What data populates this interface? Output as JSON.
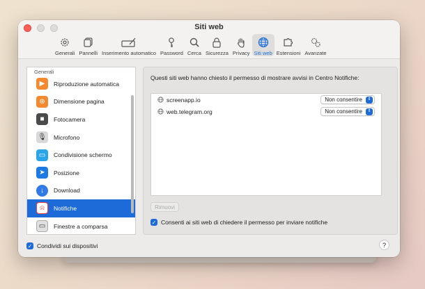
{
  "window": {
    "title": "Siti web"
  },
  "toolbar": {
    "items": [
      {
        "label": "Generali",
        "icon": "gear-icon"
      },
      {
        "label": "Pannelli",
        "icon": "tabs-icon"
      },
      {
        "label": "Inserimento automatico",
        "icon": "autofill-icon"
      },
      {
        "label": "Password",
        "icon": "key-icon"
      },
      {
        "label": "Cerca",
        "icon": "search-icon"
      },
      {
        "label": "Sicurezza",
        "icon": "lock-icon"
      },
      {
        "label": "Privacy",
        "icon": "hand-icon"
      },
      {
        "label": "Siti web",
        "icon": "globe-icon",
        "active": true
      },
      {
        "label": "Estensioni",
        "icon": "puzzle-icon"
      },
      {
        "label": "Avanzate",
        "icon": "gears-icon"
      }
    ]
  },
  "sidebar": {
    "header": "Generali",
    "items": [
      {
        "label": "Riproduzione automatica",
        "color": "#f5892d"
      },
      {
        "label": "Dimensione pagina",
        "color": "#f5892d"
      },
      {
        "label": "Fotocamera",
        "color": "#4a4a4a"
      },
      {
        "label": "Microfono",
        "color": "#8a8a8a"
      },
      {
        "label": "Condivisione schermo",
        "color": "#2aa5e8"
      },
      {
        "label": "Posizione",
        "color": "#1d7ae4"
      },
      {
        "label": "Download",
        "color": "#2f7ae6"
      },
      {
        "label": "Notifiche",
        "color": "#ff3b30",
        "selected": true
      },
      {
        "label": "Finestre a comparsa",
        "color": "#8a8a8a"
      }
    ]
  },
  "panel": {
    "description": "Questi siti web hanno chiesto il permesso di mostrare avvisi in Centro Notifiche:",
    "sites": [
      {
        "name": "screenapp.io",
        "permission": "Non consentire"
      },
      {
        "name": "web.telegram.org",
        "permission": "Non consentire"
      }
    ],
    "remove_label": "Rimuovi",
    "allow_label": "Consenti ai siti web di chiedere il permesso per inviare notifiche"
  },
  "footer": {
    "share_label": "Condividi sui dispositivi",
    "help_label": "?"
  },
  "colors": {
    "accent": "#1d6bd8",
    "close": "#ff5f57"
  }
}
